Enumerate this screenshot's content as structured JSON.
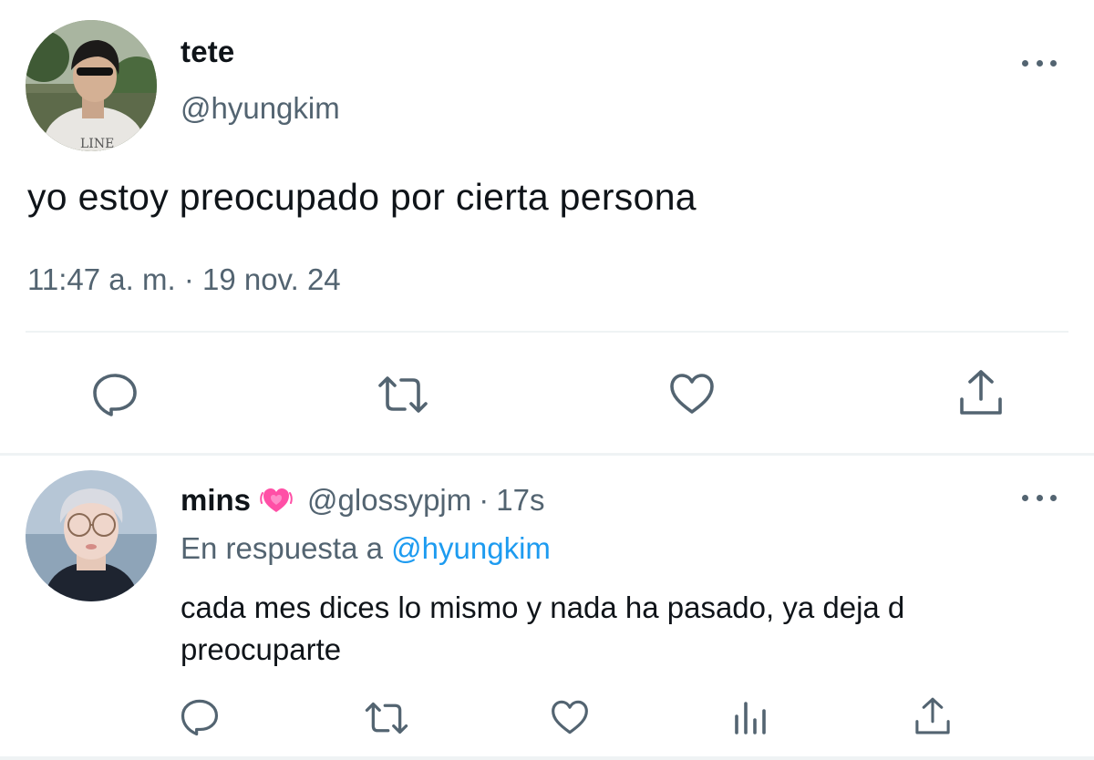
{
  "main_tweet": {
    "display_name": "tete",
    "handle": "@hyungkim",
    "text": "yo estoy preocupado por cierta persona",
    "timestamp": "11:47 a. m. · 19 nov. 24",
    "actions": [
      "reply-icon",
      "retweet-icon",
      "like-icon",
      "share-icon"
    ]
  },
  "reply_tweet": {
    "display_name": "mins",
    "name_emoji": "growing-heart-emoji",
    "handle": "@glossypjm",
    "separator": "·",
    "time_ago": "17s",
    "reply_prefix": "En respuesta a",
    "reply_mention": "@hyungkim",
    "text": "cada mes dices lo mismo y nada ha pasado, ya deja d preocuparte",
    "actions": [
      "reply-icon",
      "retweet-icon",
      "like-icon",
      "analytics-icon",
      "share-icon"
    ]
  },
  "colors": {
    "text_primary": "#0f1419",
    "text_secondary": "#536471",
    "link": "#1d9bf0",
    "divider": "#eff3f4",
    "heart_emoji": "#ff4fa6"
  }
}
